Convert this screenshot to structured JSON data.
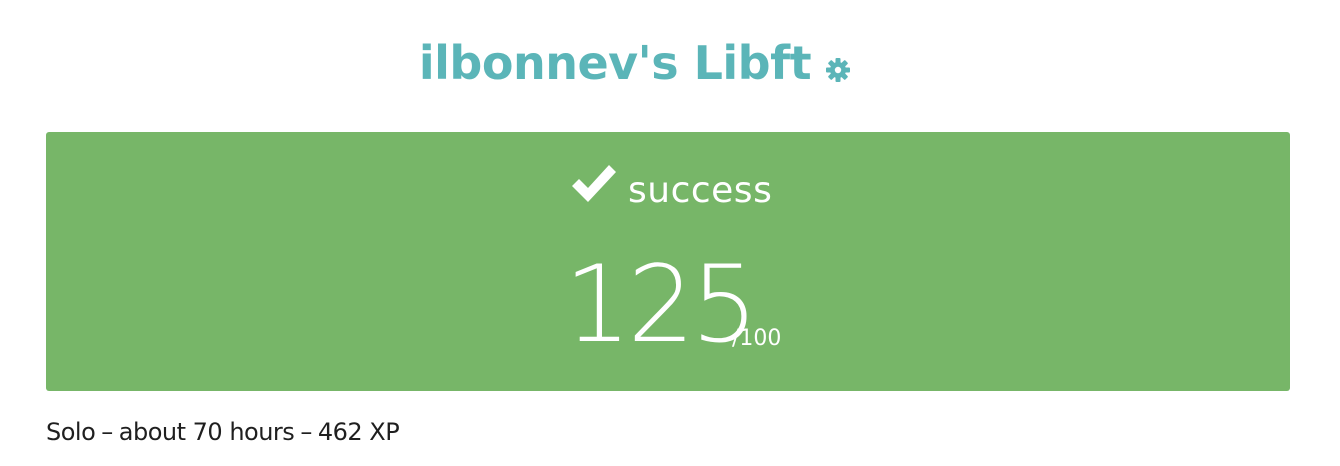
{
  "header": {
    "title": "ilbonnev's Libft",
    "settings_icon": "gear-icon",
    "accent_color": "#5bb5b8"
  },
  "result": {
    "status_icon": "check-icon",
    "status": "success",
    "score": "125",
    "max_score": "/100",
    "card_color": "#77b668"
  },
  "meta": {
    "team_type": "Solo",
    "separator": "–",
    "duration": "about 70 hours",
    "xp": "462 XP"
  }
}
